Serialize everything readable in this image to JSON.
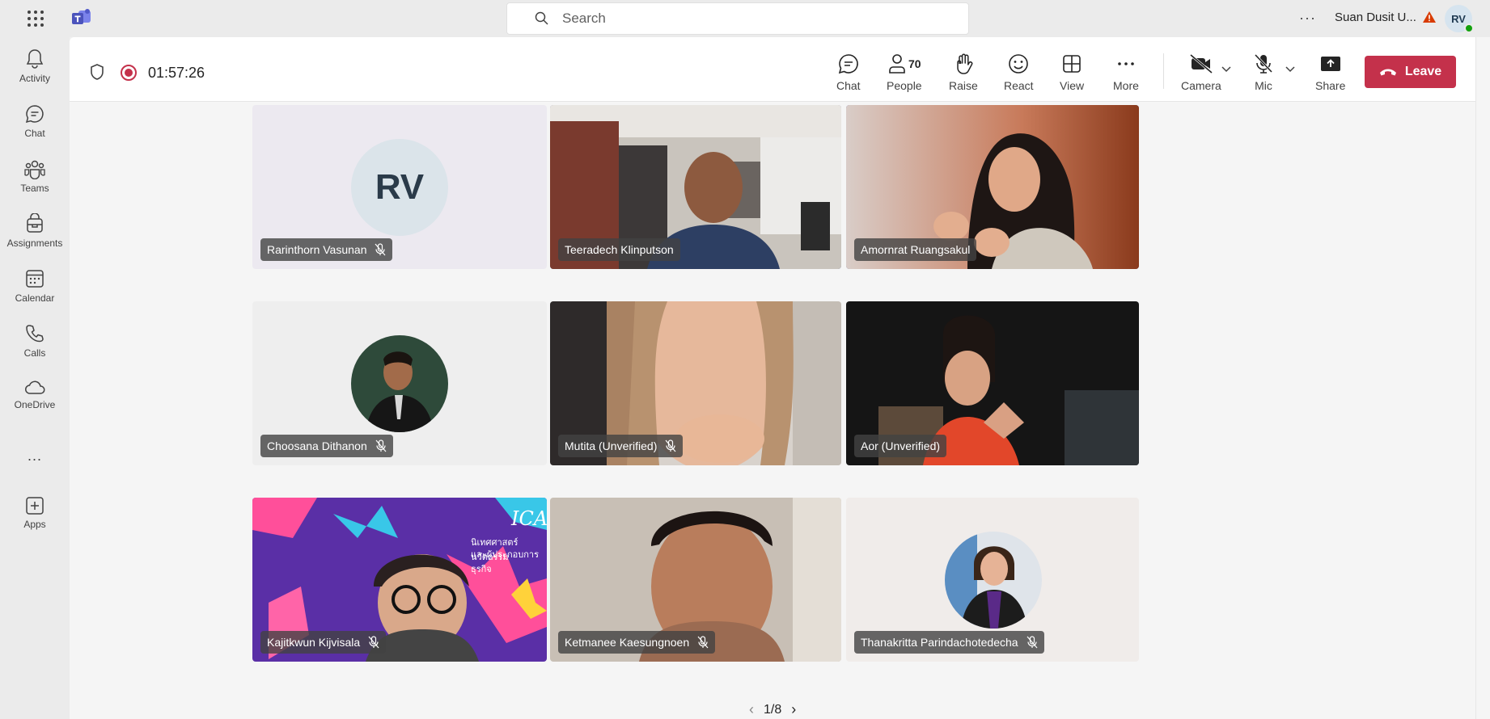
{
  "app": {
    "search_placeholder": "Search",
    "org_name": "Suan Dusit U...",
    "user_initials": "RV"
  },
  "rail": {
    "items": [
      {
        "label": "Activity",
        "icon": "bell-icon"
      },
      {
        "label": "Chat",
        "icon": "chat-icon"
      },
      {
        "label": "Teams",
        "icon": "teams-icon"
      },
      {
        "label": "Assignments",
        "icon": "assignments-icon"
      },
      {
        "label": "Calendar",
        "icon": "calendar-icon"
      },
      {
        "label": "Calls",
        "icon": "phone-icon"
      },
      {
        "label": "OneDrive",
        "icon": "cloud-icon"
      },
      {
        "label": "Apps",
        "icon": "plus-square-icon"
      }
    ],
    "more": "..."
  },
  "meeting": {
    "timer": "01:57:26",
    "controls": {
      "chat": "Chat",
      "people": "People",
      "people_count": "70",
      "raise": "Raise",
      "react": "React",
      "view": "View",
      "more": "More",
      "camera": "Camera",
      "mic": "Mic",
      "share": "Share",
      "leave": "Leave"
    },
    "pager": "1/8"
  },
  "participants": [
    {
      "name": "Rarinthorn Vasunan",
      "initials": "RV",
      "type": "initials",
      "active": false
    },
    {
      "name": "Teeradech Klinputson",
      "type": "video",
      "active": true
    },
    {
      "name": "Amornrat Ruangsakul",
      "type": "video",
      "active": true
    },
    {
      "name": "Choosana Dithanon",
      "type": "photo",
      "active": false
    },
    {
      "name": "Mutita (Unverified)",
      "type": "video",
      "active": false
    },
    {
      "name": "Aor (Unverified)",
      "type": "video",
      "active": false
    },
    {
      "name": "Kajitkwun Kijvisala",
      "type": "video",
      "active": false,
      "background_text": [
        "ICAE",
        "นิเทศศาสตร์นวัตกรรม",
        "และผู้ประกอบการธุรกิจ"
      ]
    },
    {
      "name": "Ketmanee Kaesungnoen",
      "type": "video",
      "active": false
    },
    {
      "name": "Thanakritta Parindachotedecha",
      "type": "photo",
      "active": false
    }
  ],
  "colors": {
    "accent": "#6264a7",
    "leave": "#c4314b",
    "record": "#c4314b"
  }
}
